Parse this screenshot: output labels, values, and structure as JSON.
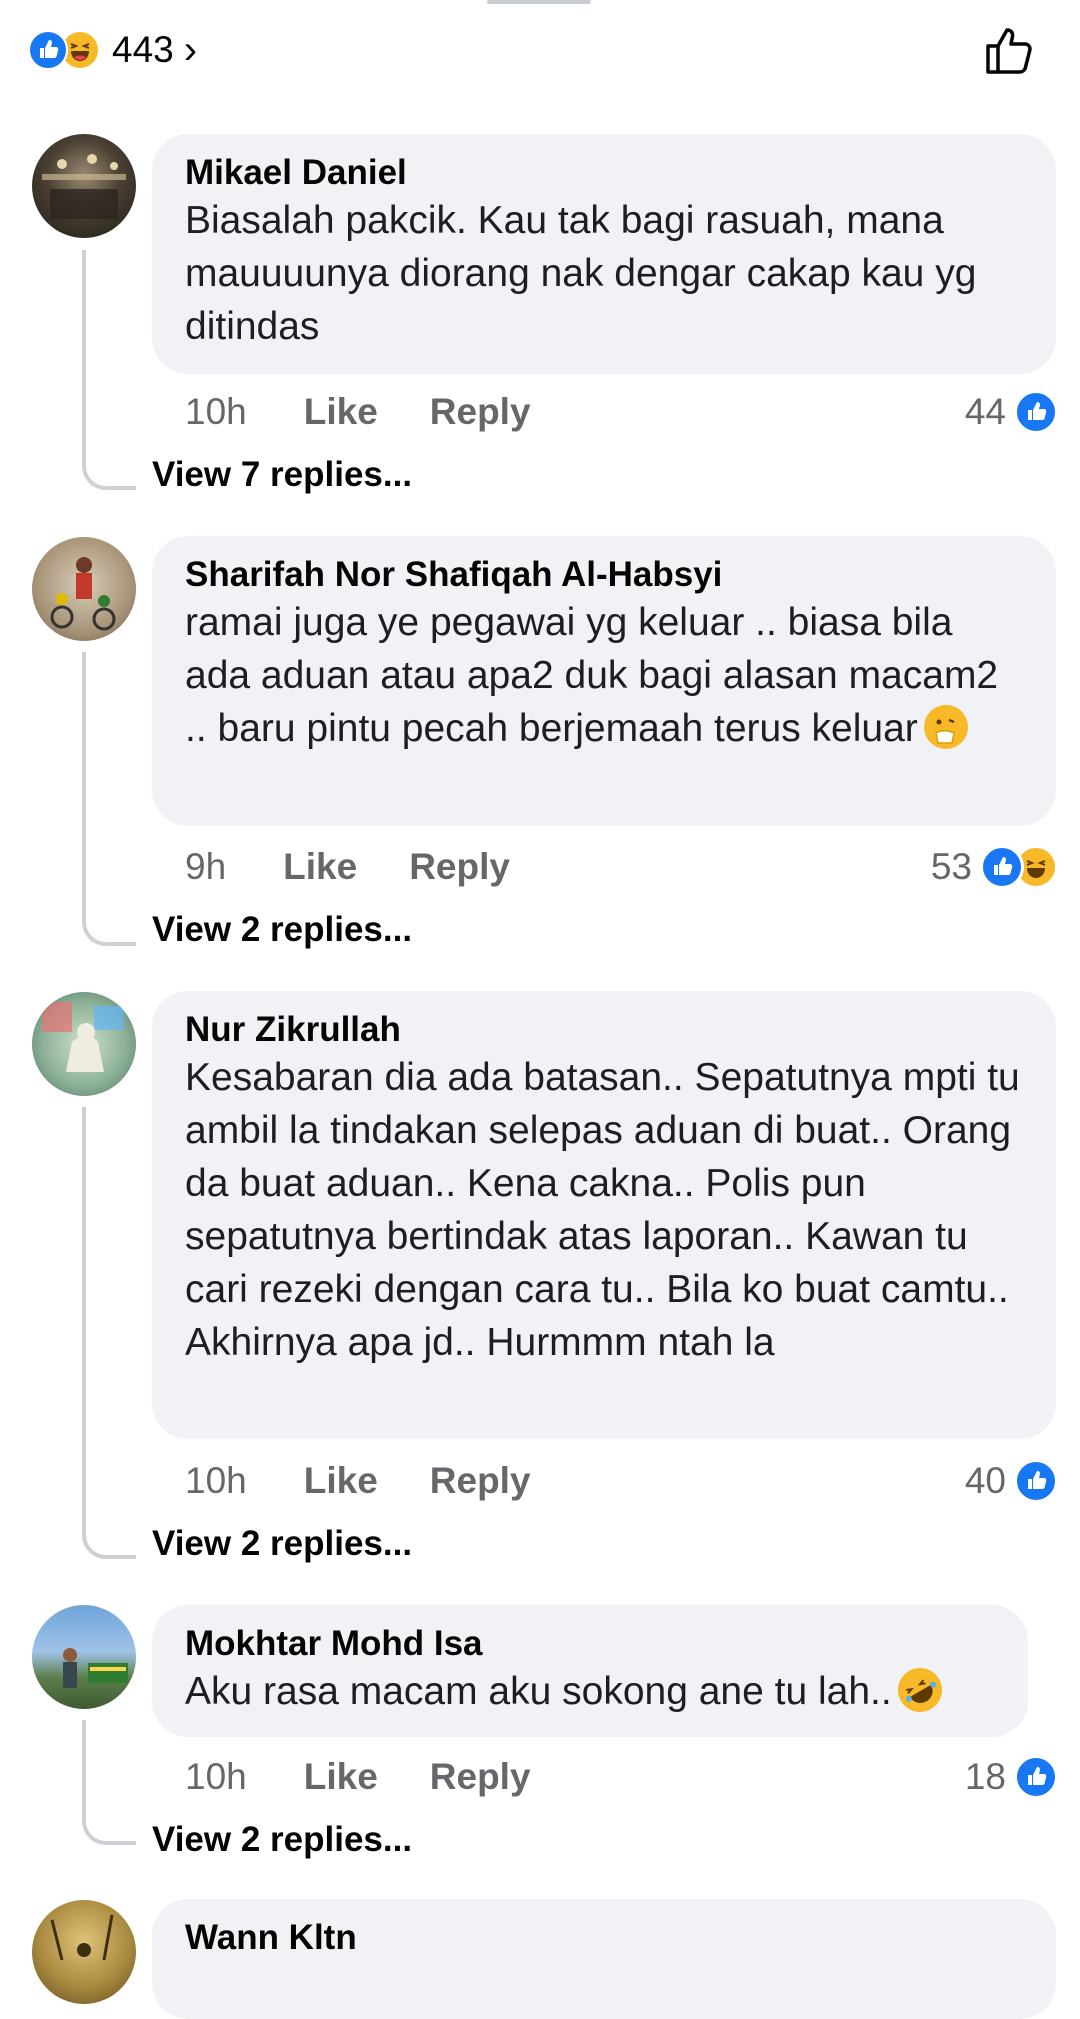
{
  "header": {
    "reaction_count": "443",
    "reaction_icons": [
      "like-icon",
      "haha-icon"
    ],
    "chevron": "›"
  },
  "comments": [
    {
      "author": "Mikael Daniel",
      "text": "Biasalah pakcik. Kau tak bagi rasuah, mana mauuuunya diorang nak dengar cakap kau yg ditindas",
      "time": "10h",
      "like_label": "Like",
      "reply_label": "Reply",
      "reaction_count": "44",
      "view_replies": "View 7 replies..."
    },
    {
      "author": "Sharifah Nor Shafiqah Al-Habsyi",
      "text": "ramai juga ye pegawai yg keluar .. biasa bila ada aduan atau apa2 duk bagi alasan macam2 .. baru pintu pecah berjemaah terus keluar",
      "time": "9h",
      "like_label": "Like",
      "reply_label": "Reply",
      "reaction_count": "53",
      "view_replies": "View 2 replies..."
    },
    {
      "author": "Nur Zikrullah",
      "text": "Kesabaran dia ada batasan.. Sepatutnya mpti tu ambil la tindakan selepas aduan di buat.. Orang da buat aduan.. Kena cakna.. Polis pun sepatutnya bertindak atas laporan.. Kawan tu cari rezeki dengan cara tu.. Bila ko buat camtu.. Akhirnya apa jd.. Hurmmm ntah la",
      "time": "10h",
      "like_label": "Like",
      "reply_label": "Reply",
      "reaction_count": "40",
      "view_replies": "View 2 replies..."
    },
    {
      "author": "Mokhtar Mohd Isa",
      "text": "Aku rasa macam aku sokong ane tu lah..",
      "time": "10h",
      "like_label": "Like",
      "reply_label": "Reply",
      "reaction_count": "18",
      "view_replies": "View 2 replies..."
    },
    {
      "author": "Wann Kltn"
    }
  ],
  "colors": {
    "like_blue": "#1877f2",
    "haha_yellow": "#f7b928",
    "bubble_bg": "#f0f2f5",
    "meta_gray": "#65676b"
  }
}
